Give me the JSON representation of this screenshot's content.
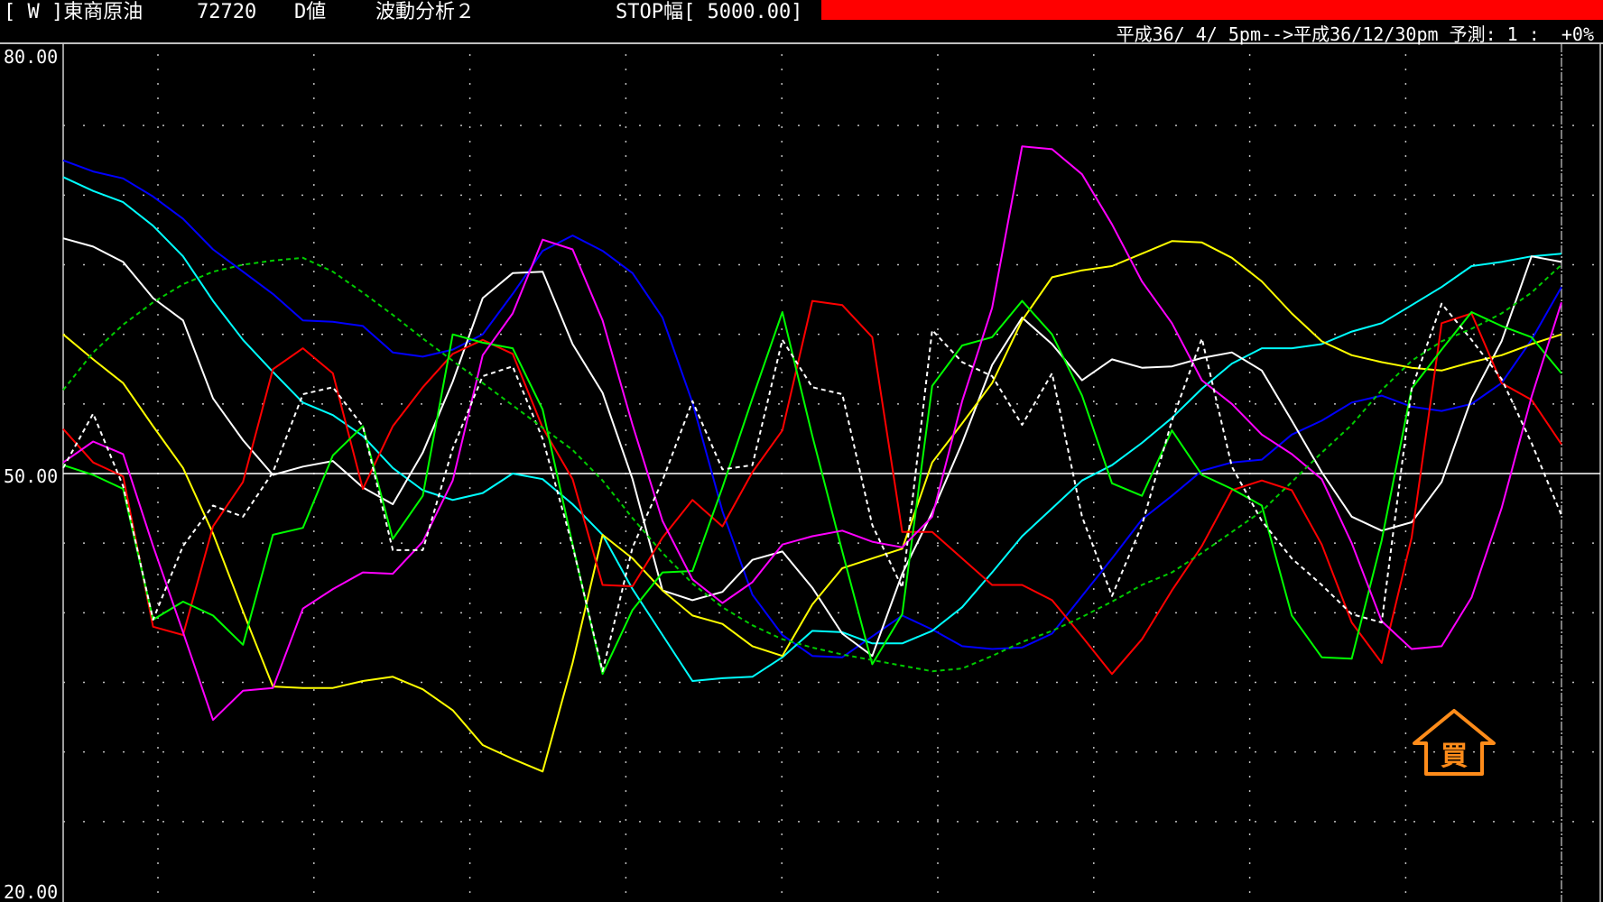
{
  "header": {
    "symbol_label": "[ W ]東商原油",
    "code": "72720",
    "value_mode": "D値",
    "analysis": "波動分析２",
    "stop_label": "STOP幅[ 5000.00]",
    "stop_bar_color": "#ff0000"
  },
  "subheader": "平成36/ 4/ 5pm-->平成36/12/30pm 予測: 1 :  +0%",
  "chart_data": {
    "type": "line",
    "ylim": [
      20,
      80
    ],
    "y_ticks": [
      "80.00",
      "50.00",
      "20.00"
    ],
    "midline": 50,
    "grid": true,
    "x": [
      0,
      1,
      2,
      3,
      4,
      5,
      6,
      7,
      8,
      9,
      10,
      11,
      12,
      13,
      14,
      15,
      16,
      17,
      18,
      19,
      20,
      21,
      22,
      23,
      24,
      25,
      26,
      27,
      28,
      29,
      30,
      31,
      32,
      33,
      34,
      35,
      36,
      37,
      38,
      39,
      40,
      41,
      42,
      43,
      44,
      45,
      46,
      47,
      48,
      49,
      50
    ],
    "series": [
      {
        "color": "#0000ff",
        "style": "solid",
        "values": [
          72.5,
          71.7,
          71.2,
          69.9,
          68.3,
          66.1,
          64.5,
          62.9,
          61.0,
          60.9,
          60.6,
          58.7,
          58.4,
          58.9,
          60.0,
          62.9,
          66.0,
          67.1,
          66.0,
          64.4,
          61.2,
          55.1,
          47.3,
          41.3,
          38.4,
          36.9,
          36.8,
          38.3,
          39.8,
          38.8,
          37.6,
          37.4,
          37.5,
          38.5,
          41.2,
          43.9,
          46.7,
          48.4,
          50.2,
          50.8,
          51.0,
          52.8,
          53.8,
          55.1,
          55.6,
          54.8,
          54.5,
          55.0,
          56.5,
          59.6,
          63.4
        ]
      },
      {
        "color": "#00ffff",
        "style": "solid",
        "values": [
          71.3,
          70.3,
          69.5,
          67.8,
          65.6,
          62.4,
          59.6,
          57.3,
          55.1,
          54.2,
          52.7,
          50.4,
          48.8,
          48.1,
          48.6,
          50.0,
          49.6,
          47.8,
          45.6,
          41.7,
          38.4,
          35.1,
          35.3,
          35.4,
          36.8,
          38.7,
          38.6,
          37.8,
          37.8,
          38.7,
          40.4,
          42.9,
          45.5,
          47.5,
          49.5,
          50.6,
          52.2,
          54.0,
          56.1,
          57.9,
          59.0,
          59.0,
          59.3,
          60.2,
          60.8,
          62.1,
          63.4,
          64.9,
          65.2,
          65.6,
          65.8
        ]
      },
      {
        "color": "#ffffff",
        "style": "solid",
        "values": [
          66.9,
          66.3,
          65.2,
          62.6,
          61.0,
          55.4,
          52.4,
          49.9,
          50.5,
          50.9,
          49.0,
          47.8,
          51.5,
          56.6,
          62.6,
          64.4,
          64.5,
          59.3,
          55.8,
          49.6,
          41.6,
          40.9,
          41.5,
          43.8,
          44.4,
          41.8,
          38.5,
          36.9,
          42.8,
          47.2,
          52.2,
          57.8,
          61.2,
          59.3,
          56.7,
          58.2,
          57.6,
          57.7,
          58.3,
          58.7,
          57.4,
          53.8,
          50.1,
          46.9,
          45.9,
          46.5,
          49.4,
          55.4,
          59.5,
          65.6,
          65.2
        ]
      },
      {
        "color": "#ffff00",
        "style": "solid",
        "values": [
          60.0,
          58.2,
          56.5,
          53.4,
          50.4,
          45.7,
          40.1,
          34.7,
          34.6,
          34.6,
          35.1,
          35.4,
          34.5,
          33.0,
          30.5,
          29.5,
          28.6,
          36.4,
          45.6,
          43.9,
          41.6,
          39.8,
          39.2,
          37.6,
          36.9,
          40.6,
          43.2,
          43.9,
          44.6,
          50.8,
          53.6,
          56.5,
          61.0,
          64.1,
          64.6,
          64.9,
          65.8,
          66.7,
          66.6,
          65.5,
          63.8,
          61.5,
          59.5,
          58.5,
          58.0,
          57.6,
          57.4,
          58.0,
          58.5,
          59.3,
          60.0
        ]
      },
      {
        "color": "#ff0000",
        "style": "solid",
        "values": [
          53.2,
          50.8,
          49.8,
          39.0,
          38.4,
          46.2,
          49.4,
          57.5,
          59.0,
          57.2,
          48.9,
          53.4,
          56.2,
          58.6,
          59.6,
          58.6,
          53.3,
          49.6,
          42.0,
          41.9,
          45.4,
          48.1,
          46.2,
          50.1,
          53.1,
          62.4,
          62.1,
          59.8,
          45.8,
          45.8,
          43.9,
          42.0,
          42.0,
          40.9,
          38.3,
          35.6,
          38.1,
          41.6,
          44.8,
          48.8,
          49.5,
          48.8,
          44.9,
          39.3,
          36.4,
          45.4,
          60.8,
          61.5,
          56.5,
          55.3,
          52.1
        ]
      },
      {
        "color": "#00ff00",
        "style": "solid",
        "values": [
          50.6,
          49.9,
          48.9,
          39.5,
          40.8,
          39.8,
          37.7,
          45.6,
          46.1,
          51.3,
          53.4,
          45.3,
          48.4,
          60.0,
          59.4,
          59.0,
          54.6,
          44.9,
          35.6,
          40.2,
          42.9,
          43.0,
          49.0,
          55.4,
          61.6,
          52.7,
          44.4,
          36.3,
          39.9,
          56.3,
          59.2,
          59.8,
          62.4,
          60.0,
          55.6,
          49.3,
          48.4,
          53.1,
          49.9,
          48.9,
          47.7,
          39.8,
          36.8,
          36.7,
          45.2,
          56.1,
          58.9,
          61.6,
          60.6,
          59.8,
          57.2
        ]
      },
      {
        "color": "#ff00ff",
        "style": "solid",
        "values": [
          50.8,
          52.3,
          51.4,
          44.8,
          38.6,
          32.3,
          34.4,
          34.6,
          40.3,
          41.7,
          42.9,
          42.8,
          45.1,
          49.5,
          58.5,
          61.5,
          66.8,
          66.1,
          61.0,
          53.5,
          46.6,
          42.4,
          40.7,
          42.2,
          44.9,
          45.5,
          45.9,
          45.1,
          44.7,
          46.9,
          55.2,
          61.9,
          73.5,
          73.3,
          71.5,
          67.9,
          63.8,
          60.8,
          56.7,
          55.0,
          52.8,
          51.4,
          49.6,
          45.0,
          39.4,
          37.4,
          37.6,
          41.1,
          47.5,
          55.5,
          62.3
        ]
      },
      {
        "color": "#ffffff",
        "style": "dash",
        "values": [
          50.4,
          54.3,
          49.1,
          39.5,
          44.8,
          47.7,
          46.9,
          50.1,
          55.7,
          56.2,
          53.4,
          44.5,
          44.5,
          51.8,
          57.0,
          57.7,
          52.5,
          44.8,
          35.8,
          44.7,
          49.5,
          55.2,
          50.3,
          50.6,
          59.6,
          56.2,
          55.7,
          46.3,
          41.8,
          60.3,
          58.0,
          57.0,
          53.5,
          57.2,
          46.9,
          41.2,
          46.3,
          53.8,
          59.7,
          50.5,
          46.6,
          43.9,
          42.0,
          39.9,
          39.3,
          56.1,
          62.2,
          59.6,
          56.8,
          52.2,
          47.0
        ]
      },
      {
        "color": "#00cc00",
        "style": "dash",
        "values": [
          56.0,
          58.7,
          60.7,
          62.3,
          63.6,
          64.5,
          65.0,
          65.3,
          65.5,
          64.5,
          63.0,
          61.4,
          59.7,
          58.1,
          56.5,
          54.9,
          53.3,
          51.7,
          49.5,
          46.8,
          44.3,
          42.1,
          40.4,
          39.1,
          38.1,
          37.5,
          37.0,
          36.6,
          36.2,
          35.8,
          36.0,
          36.9,
          37.9,
          38.7,
          39.7,
          40.8,
          42.0,
          42.9,
          44.3,
          45.8,
          47.3,
          49.4,
          51.5,
          53.5,
          56.0,
          58.1,
          59.5,
          60.4,
          61.5,
          63.0,
          65.0
        ]
      }
    ]
  }
}
